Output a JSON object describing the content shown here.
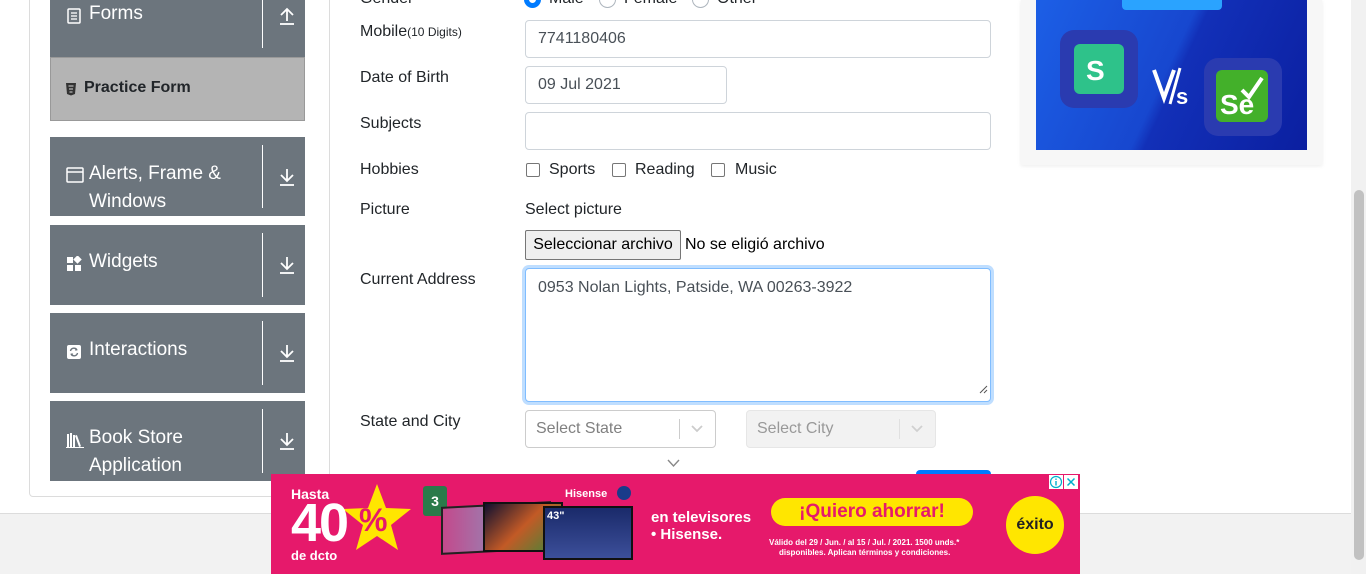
{
  "sidebar": {
    "groups": [
      {
        "label": "Forms"
      },
      {
        "label": "Alerts, Frame &",
        "label2": "Windows"
      },
      {
        "label": "Widgets"
      },
      {
        "label": "Interactions"
      },
      {
        "label": "Book Store",
        "label2": "Application"
      }
    ],
    "active_item": "Practice Form"
  },
  "form": {
    "gender_label": "Gender",
    "gender_options": [
      "Male",
      "Female",
      "Other"
    ],
    "mobile_label": "Mobile",
    "mobile_hint": "(10 Digits)",
    "mobile_value": "7741180406",
    "dob_label": "Date of Birth",
    "dob_value": "09 Jul 2021",
    "subjects_label": "Subjects",
    "subjects_value": "",
    "hobbies_label": "Hobbies",
    "hobbies": [
      "Sports",
      "Reading",
      "Music"
    ],
    "picture_label": "Picture",
    "picture_prompt": "Select picture",
    "file_button": "Seleccionar archivo",
    "file_status": "No se eligió archivo",
    "address_label": "Current Address",
    "address_value": "0953 Nolan Lights, Patside, WA 00263-3922",
    "state_city_label": "State and City",
    "state_placeholder": "Select State",
    "city_placeholder": "Select City"
  },
  "ad": {
    "prefix": "Hasta",
    "percent": "40",
    "suffix": "de dcto",
    "years_badge": "3",
    "brand": "Hisense",
    "size_badge": "43\"",
    "text1": "en televisores",
    "text2": "• Hisense.",
    "cta": "¡Quiero ahorrar!",
    "legal1": "Válido del 29 / Jun. / al 15 / Jul. / 2021. 1500 unds.*",
    "legal2": "disponibles. Aplican términos y condiciones.",
    "store": "éxito"
  },
  "colors": {
    "sidebar_bg": "#6c757d",
    "active_bg": "#b4b4b4",
    "accent": "#007bff",
    "ad_bg": "#e6196b",
    "ad_yellow": "#ffe600"
  }
}
